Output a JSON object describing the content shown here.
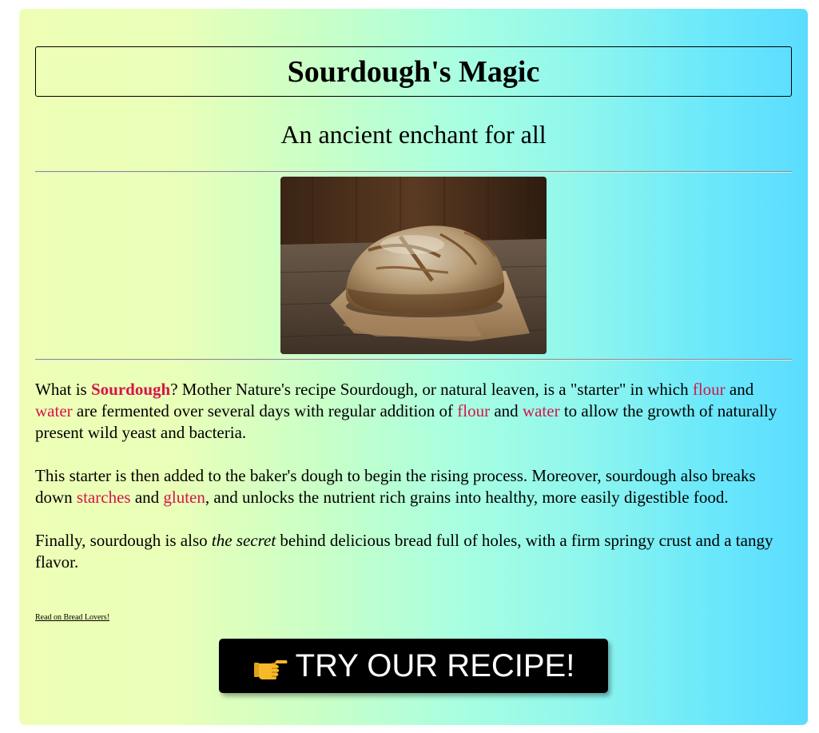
{
  "header": {
    "title": "Sourdough's Magic",
    "subtitle": "An ancient enchant for all"
  },
  "hero_image": {
    "subject": "rustic sourdough loaf on brown paper on a wooden table"
  },
  "article": {
    "p1": {
      "t1": "What is ",
      "sourdough": "Sourdough",
      "t2": "? Mother Nature's recipe Sourdough, or natural leaven, is a \"starter\" in which ",
      "flour1": "flour",
      "t3": " and ",
      "water1": "water",
      "t4": " are fermented over several days with regular addition of ",
      "flour2": "flour",
      "t5": " and ",
      "water2": "water",
      "t6": " to allow the growth of naturally present wild yeast and bacteria."
    },
    "p2": {
      "t1": "This starter is then added to the baker's dough to begin the rising process. Moreover, sourdough also breaks down ",
      "starches": "starches",
      "t2": " and ",
      "gluten": "gluten",
      "t3": ", and unlocks the nutrient rich grains into healthy, more easily digestible food."
    },
    "p3": {
      "t1": "Finally, sourdough is also ",
      "secret": "the secret",
      "t2": " behind delicious bread full of holes, with a firm springy crust and a tangy flavor."
    }
  },
  "links": {
    "read_more": "Read on Bread Lovers!"
  },
  "cta": {
    "label": "TRY OUR RECIPE!",
    "icon": "pointing-hand-icon"
  },
  "colors": {
    "highlight": "#d4154a",
    "gradient_start": "#eeffb5",
    "gradient_end": "#5adcff",
    "button_bg": "#000000"
  }
}
